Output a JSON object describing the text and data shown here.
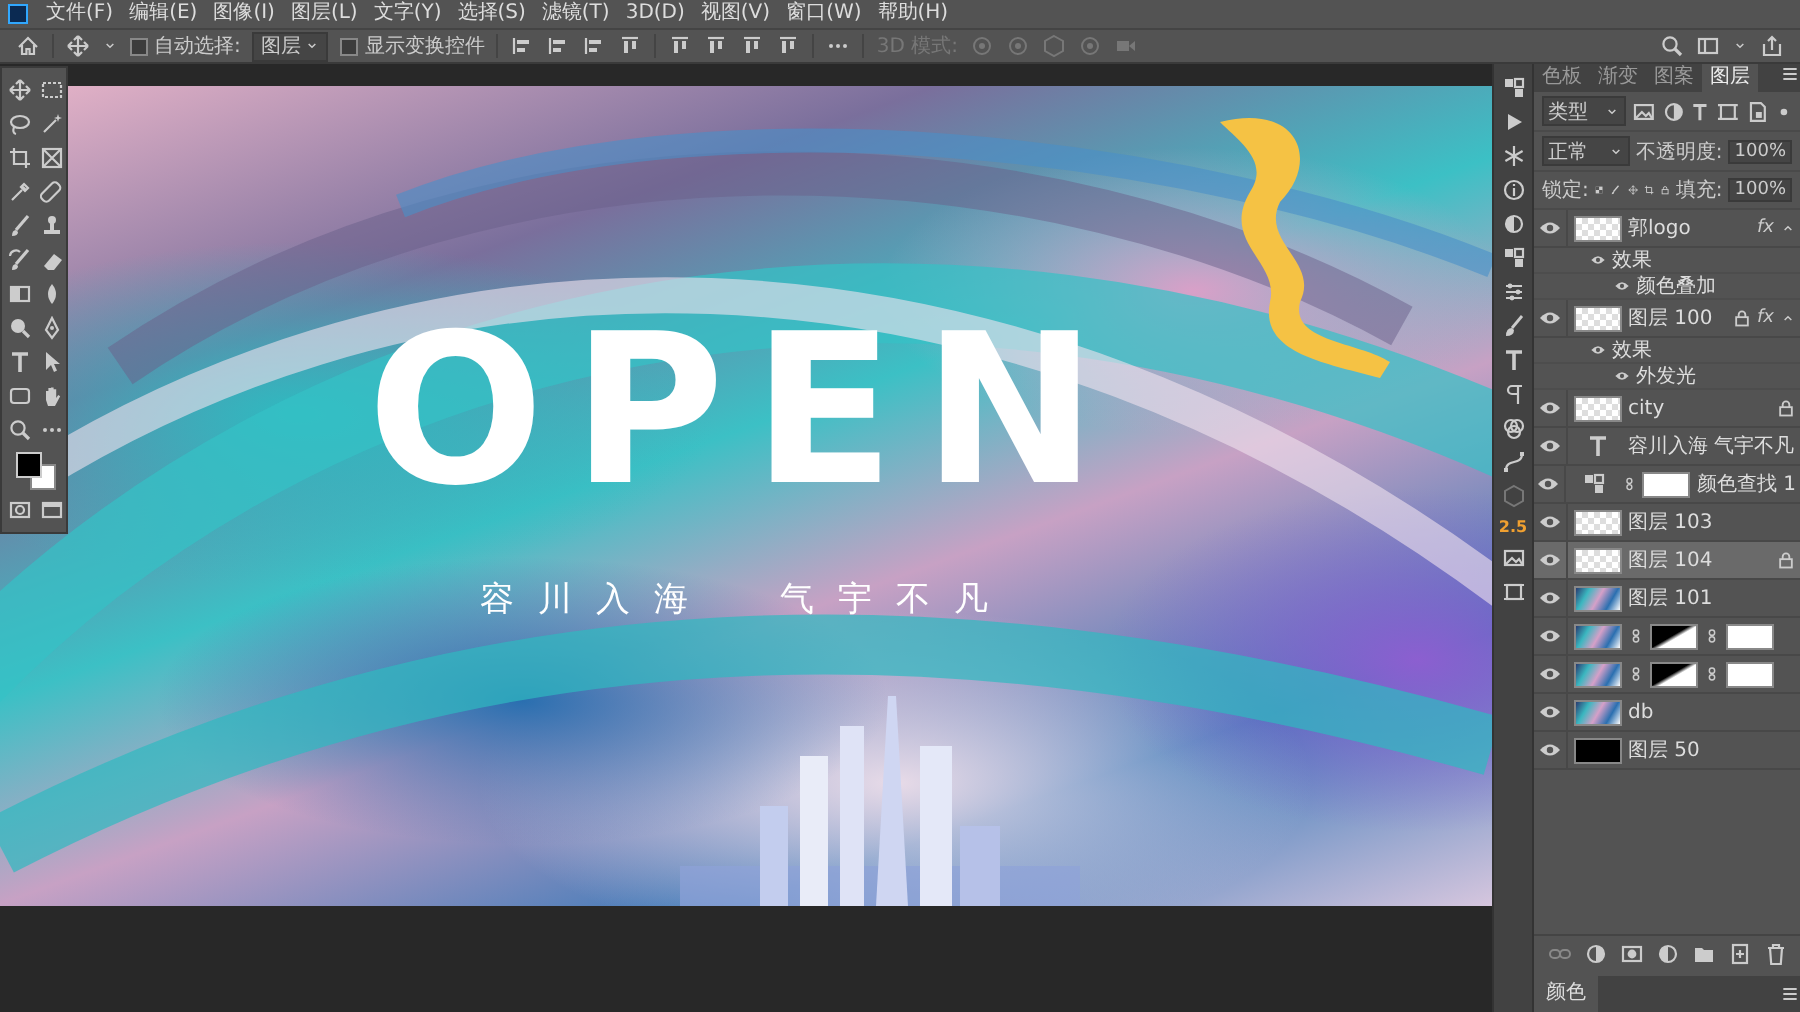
{
  "menu_bar": {
    "items": [
      "文件(F)",
      "编辑(E)",
      "图像(I)",
      "图层(L)",
      "文字(Y)",
      "选择(S)",
      "滤镜(T)",
      "3D(D)",
      "视图(V)",
      "窗口(W)",
      "帮助(H)"
    ]
  },
  "options_bar": {
    "auto_select": {
      "label": "自动选择:",
      "checked": false
    },
    "auto_select_target": "图层",
    "show_transform": {
      "label": "显示变换控件",
      "checked": false
    },
    "mode_3d": "3D 模式:"
  },
  "canvas": {
    "title": "OPEN",
    "tagline_left": "容川入海",
    "tagline_right": "气宇不凡"
  },
  "dock": {
    "badge": "2.5"
  },
  "layers_panel": {
    "tabs": [
      {
        "label": "色板",
        "selected": false
      },
      {
        "label": "渐变",
        "selected": false
      },
      {
        "label": "图案",
        "selected": false
      },
      {
        "label": "图层",
        "selected": true
      }
    ],
    "filter": "类型",
    "blend_mode": "正常",
    "opacity_label": "不透明度:",
    "opacity": "100%",
    "lock_label": "锁定:",
    "fill_label": "填充:",
    "fill": "100%",
    "layers": [
      {
        "name": "郭logo",
        "kind": "transparent",
        "visible": true,
        "selected": false,
        "locked": false,
        "fx": "fx",
        "expanded": true,
        "effects": {
          "label": "效果",
          "items": [
            "颜色叠加"
          ]
        }
      },
      {
        "name": "图层 100",
        "kind": "transparent",
        "visible": true,
        "selected": false,
        "locked": true,
        "fx": "fx",
        "expanded": true,
        "effects": {
          "label": "效果",
          "items": [
            "外发光"
          ]
        }
      },
      {
        "name": "city",
        "kind": "transparent",
        "visible": true,
        "selected": false,
        "locked": true
      },
      {
        "name": "容川入海 气宇不凡",
        "kind": "text",
        "visible": true,
        "selected": false,
        "locked": false
      },
      {
        "name": "颜色查找 1",
        "kind": "adjustment",
        "visible": true,
        "selected": false,
        "locked": false,
        "masks": [
          {
            "kind": "white"
          }
        ]
      },
      {
        "name": "图层 103",
        "kind": "transparent",
        "visible": true,
        "selected": false,
        "locked": false
      },
      {
        "name": "图层 104",
        "kind": "transparent",
        "visible": true,
        "selected": true,
        "locked": true
      },
      {
        "name": "图层 101",
        "kind": "image",
        "visible": true,
        "selected": false,
        "locked": false
      },
      {
        "kind": "image",
        "visible": true,
        "selected": false,
        "locked": false,
        "masks": [
          {
            "kind": "gradient"
          },
          {
            "kind": "white"
          }
        ]
      },
      {
        "kind": "image",
        "visible": true,
        "selected": false,
        "locked": false,
        "masks": [
          {
            "kind": "gradient"
          },
          {
            "kind": "white"
          }
        ]
      },
      {
        "name": "db",
        "kind": "image",
        "visible": true,
        "selected": false,
        "locked": false
      },
      {
        "name": "图层 50",
        "kind": "solid",
        "visible": true,
        "selected": false,
        "locked": false
      }
    ]
  },
  "color_panel": {
    "tab": "颜色"
  }
}
